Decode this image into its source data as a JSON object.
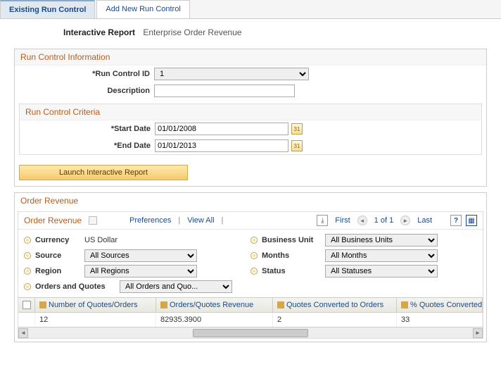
{
  "tabs": {
    "existing": "Existing Run Control",
    "addnew": "Add New Run Control"
  },
  "page_title": {
    "label": "Interactive Report",
    "value": "Enterprise Order Revenue"
  },
  "runcontrol": {
    "section_title": "Run Control Information",
    "id_label": "*Run Control ID",
    "id_value": "1",
    "desc_label": "Description",
    "desc_value": "",
    "criteria_title": "Run Control Criteria",
    "start_label": "*Start Date",
    "start_value": "01/01/2008",
    "end_label": "*End Date",
    "end_value": "01/01/2013",
    "launch_label": "Launch Interactive Report"
  },
  "grid": {
    "section_title": "Order Revenue",
    "toolbar": {
      "title": "Order Revenue",
      "preferences": "Preferences",
      "viewall": "View All",
      "first": "First",
      "pager": "1 of 1",
      "last": "Last"
    },
    "filters": {
      "currency": {
        "label": "Currency",
        "value": "US Dollar"
      },
      "businessunit": {
        "label": "Business Unit",
        "value": "All Business Units"
      },
      "source": {
        "label": "Source",
        "value": "All Sources"
      },
      "months": {
        "label": "Months",
        "value": "All Months"
      },
      "region": {
        "label": "Region",
        "value": "All Regions"
      },
      "status": {
        "label": "Status",
        "value": "All Statuses"
      },
      "ordersquotes": {
        "label": "Orders and Quotes",
        "value": "All Orders and Quo..."
      }
    },
    "columns": {
      "c1": "Number of Quotes/Orders",
      "c2": "Orders/Quotes Revenue",
      "c3": "Quotes Converted to Orders",
      "c4": "% Quotes Converted to"
    },
    "row": {
      "c1": "12",
      "c2": "82935.3900",
      "c3": "2",
      "c4": "33"
    }
  }
}
